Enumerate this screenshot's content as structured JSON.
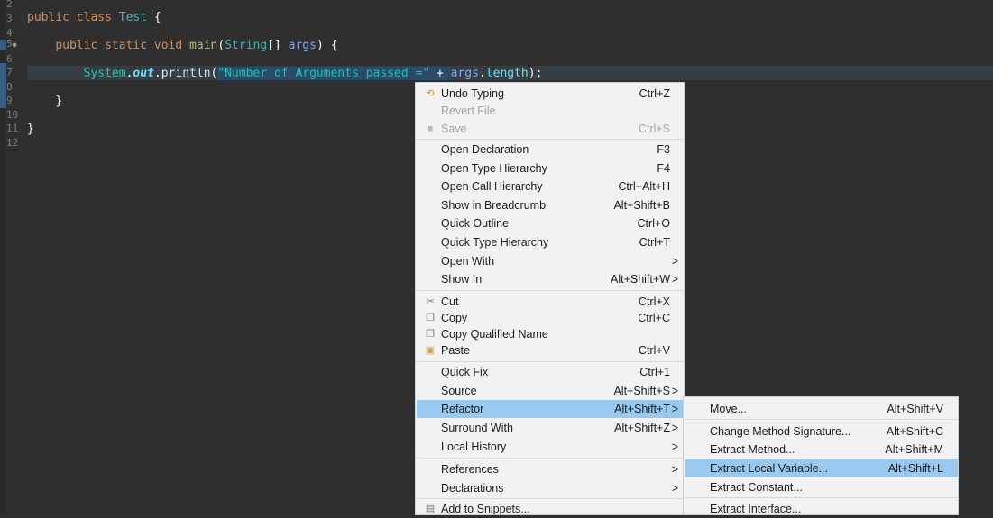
{
  "editor": {
    "line_numbers": [
      "2",
      "3",
      "4",
      "5",
      "6",
      "7",
      "8",
      "9",
      "10",
      "11",
      "12"
    ],
    "code": {
      "line3": {
        "kw1": "public",
        "kw2": "class",
        "name": "Test",
        "brace": "{"
      },
      "line5": {
        "kw1": "public",
        "kw2": "static",
        "kw3": "void",
        "method": "main",
        "open": "(",
        "type": "String",
        "arr": "[]",
        "param": "args",
        "close": ")",
        "brace": "{"
      },
      "line7": {
        "sys": "System",
        "dot1": ".",
        "out": "out",
        "dot2": ".",
        "println": "println",
        "open": "(",
        "str": "\"Number of Arguments passed =\"",
        "plus": " + ",
        "args": "args",
        "dot3": ".",
        "length": "length",
        "close": ");"
      },
      "line9": {
        "brace": "}"
      },
      "line11": {
        "brace": "}"
      }
    }
  },
  "context_menu": {
    "items": [
      {
        "label": "Undo Typing",
        "accel": "Ctrl+Z",
        "icon": "undo-icon"
      },
      {
        "label": "Revert File",
        "accel": ""
      },
      {
        "label": "Save",
        "accel": "Ctrl+S",
        "icon": "save-icon"
      },
      {
        "label": "Open Declaration",
        "accel": "F3"
      },
      {
        "label": "Open Type Hierarchy",
        "accel": "F4"
      },
      {
        "label": "Open Call Hierarchy",
        "accel": "Ctrl+Alt+H"
      },
      {
        "label": "Show in Breadcrumb",
        "accel": "Alt+Shift+B"
      },
      {
        "label": "Quick Outline",
        "accel": "Ctrl+O"
      },
      {
        "label": "Quick Type Hierarchy",
        "accel": "Ctrl+T"
      },
      {
        "label": "Open With",
        "accel": ""
      },
      {
        "label": "Show In",
        "accel": "Alt+Shift+W"
      },
      {
        "label": "Cut",
        "accel": "Ctrl+X",
        "icon": "scissors-icon"
      },
      {
        "label": "Copy",
        "accel": "Ctrl+C",
        "icon": "copy-icon"
      },
      {
        "label": "Copy Qualified Name",
        "accel": "",
        "icon": "copy-qualified-icon"
      },
      {
        "label": "Paste",
        "accel": "Ctrl+V",
        "icon": "paste-icon"
      },
      {
        "label": "Quick Fix",
        "accel": "Ctrl+1"
      },
      {
        "label": "Source",
        "accel": "Alt+Shift+S"
      },
      {
        "label": "Refactor",
        "accel": "Alt+Shift+T"
      },
      {
        "label": "Surround With",
        "accel": "Alt+Shift+Z"
      },
      {
        "label": "Local History",
        "accel": ""
      },
      {
        "label": "References",
        "accel": ""
      },
      {
        "label": "Declarations",
        "accel": ""
      },
      {
        "label": "Add to Snippets...",
        "accel": "",
        "icon": "snippet-icon"
      }
    ],
    "arrow": ">"
  },
  "refactor_submenu": {
    "items": [
      {
        "label": "Move...",
        "accel": "Alt+Shift+V"
      },
      {
        "label": "Change Method Signature...",
        "accel": "Alt+Shift+C"
      },
      {
        "label": "Extract Method...",
        "accel": "Alt+Shift+M"
      },
      {
        "label": "Extract Local Variable...",
        "accel": "Alt+Shift+L"
      },
      {
        "label": "Extract Constant...",
        "accel": ""
      },
      {
        "label": "Extract Interface...",
        "accel": ""
      }
    ]
  },
  "colors": {
    "editor_background": "#2f2f2f",
    "menu_background": "#f2f2f2",
    "menu_highlight": "#99c9ef"
  }
}
